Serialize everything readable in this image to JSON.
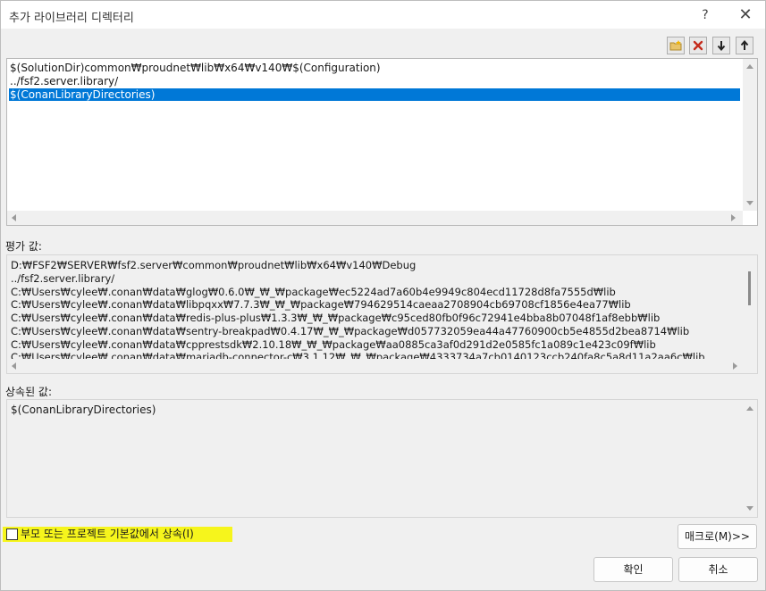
{
  "window": {
    "title": "추가 라이브러리 디렉터리",
    "help_glyph": "?",
    "close_glyph": "✕"
  },
  "toolbar": {
    "icons": [
      "new-folder-icon",
      "delete-icon",
      "move-down-icon",
      "move-up-icon"
    ]
  },
  "directory_list": {
    "items": [
      "$(SolutionDir)common₩proudnet₩lib₩x64₩v140₩$(Configuration)",
      "../fsf2.server.library/",
      "$(ConanLibraryDirectories)"
    ],
    "selected_index": 2
  },
  "evaluated": {
    "label": "평가 값:",
    "lines": [
      "D:₩FSF2₩SERVER₩fsf2.server₩common₩proudnet₩lib₩x64₩v140₩Debug",
      "../fsf2.server.library/",
      "C:₩Users₩cylee₩.conan₩data₩glog₩0.6.0₩_₩_₩package₩ec5224ad7a60b4e9949c804ecd11728d8fa7555d₩lib",
      "C:₩Users₩cylee₩.conan₩data₩libpqxx₩7.7.3₩_₩_₩package₩794629514caeaa2708904cb69708cf1856e4ea77₩lib",
      "C:₩Users₩cylee₩.conan₩data₩redis-plus-plus₩1.3.3₩_₩_₩package₩c95ced80fb0f96c72941e4bba8b07048f1af8ebb₩lib",
      "C:₩Users₩cylee₩.conan₩data₩sentry-breakpad₩0.4.17₩_₩_₩package₩d057732059ea44a47760900cb5e4855d2bea8714₩lib",
      "C:₩Users₩cylee₩.conan₩data₩cpprestsdk₩2.10.18₩_₩_₩package₩aa0885ca3af0d291d2e0585fc1a089c1e423c09f₩lib",
      "C:₩Users₩cylee₩.conan₩data₩mariadb-connector-c₩3.1.12₩_₩_₩package₩4333734a7cb0140123ccb240fa8c5a8d11a2aa6c₩lib"
    ]
  },
  "inherited": {
    "label": "상속된 값:",
    "lines": [
      "$(ConanLibraryDirectories)"
    ]
  },
  "inherit_checkbox": {
    "label": "부모 또는 프로젝트 기본값에서 상속(I)",
    "checked": false,
    "highlight_color": "#f6f51c"
  },
  "buttons": {
    "macro": "매크로(M)>>",
    "ok": "확인",
    "cancel": "취소"
  },
  "colors": {
    "selection": "#0078d7",
    "delete_icon": "#c42b1c"
  }
}
